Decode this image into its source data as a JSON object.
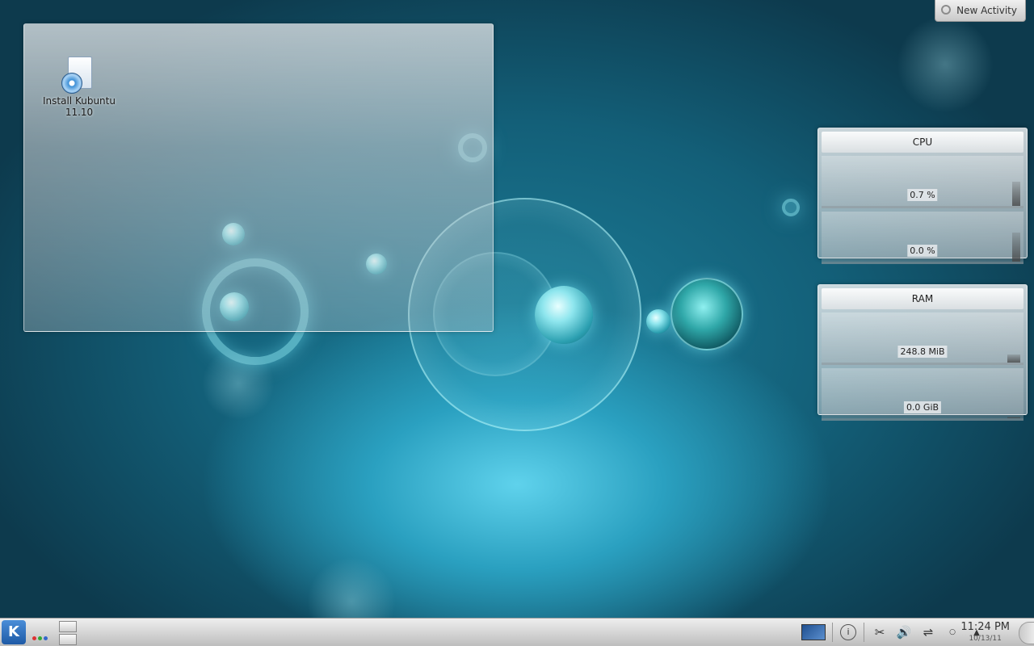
{
  "desktop": {
    "icon": {
      "label": "Install Kubuntu 11.10"
    }
  },
  "activity": {
    "label": "New Activity"
  },
  "cpu_widget": {
    "title": "CPU",
    "values": [
      "0.7 %",
      "0.0 %"
    ]
  },
  "ram_widget": {
    "title": "RAM",
    "values": [
      "248.8 MiB",
      "0.0 GiB"
    ]
  },
  "taskbar": {
    "kmenu_glyph": "K",
    "clock": {
      "time": "11:24 PM",
      "date": "10/13/11"
    },
    "tray_icons": [
      "display-icon",
      "info-icon",
      "klipper-scissors-icon",
      "volume-icon",
      "network-icon",
      "expand-arrow-icon"
    ]
  },
  "colors": {
    "desktop_teal": "#135f78",
    "kmenu_blue": "#1e5aa6"
  }
}
